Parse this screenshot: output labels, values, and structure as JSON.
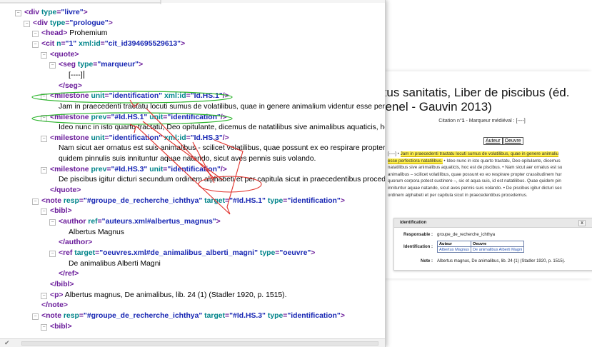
{
  "editor": {
    "lines": [
      {
        "indent": 34,
        "tog": true,
        "parts": [
          [
            "tg",
            "<div "
          ],
          [
            "at",
            "type"
          ],
          [
            "tg",
            "="
          ],
          [
            "av",
            "\"livre\""
          ],
          [
            "tg",
            ">"
          ]
        ]
      },
      {
        "indent": 46,
        "tog": true,
        "parts": [
          [
            "tg",
            "<div "
          ],
          [
            "at",
            "type"
          ],
          [
            "tg",
            "="
          ],
          [
            "av",
            "\"prologue\""
          ],
          [
            "tg",
            ">"
          ]
        ]
      },
      {
        "indent": 58,
        "tog": true,
        "parts": [
          [
            "tg",
            "<head>"
          ],
          [
            "tx",
            " Prohemium"
          ]
        ]
      },
      {
        "indent": 58,
        "tog": true,
        "parts": [
          [
            "tg",
            "<cit "
          ],
          [
            "at",
            "n"
          ],
          [
            "tg",
            "="
          ],
          [
            "av",
            "\"1\" "
          ],
          [
            "at",
            "xml:id"
          ],
          [
            "tg",
            "="
          ],
          [
            "av",
            "\"cit_id394695529613\""
          ],
          [
            "tg",
            ">"
          ]
        ]
      },
      {
        "indent": 70,
        "tog": true,
        "parts": [
          [
            "tg",
            "<quote>"
          ]
        ]
      },
      {
        "indent": 82,
        "tog": true,
        "parts": [
          [
            "tg",
            "<seg "
          ],
          [
            "at",
            "type"
          ],
          [
            "tg",
            "="
          ],
          [
            "av",
            "\"marqueur\""
          ],
          [
            "tg",
            ">"
          ]
        ]
      },
      {
        "indent": 96,
        "tog": false,
        "cursor": true,
        "parts": [
          [
            "tx",
            "[----]"
          ]
        ]
      },
      {
        "indent": 82,
        "tog": false,
        "parts": [
          [
            "tg",
            "</seg>"
          ]
        ]
      },
      {
        "indent": 70,
        "tog": true,
        "parts": [
          [
            "tg",
            "<milestone "
          ],
          [
            "at",
            "unit"
          ],
          [
            "tg",
            "="
          ],
          [
            "av",
            "\"identification\" "
          ],
          [
            "at",
            "xml:id"
          ],
          [
            "tg",
            "="
          ],
          [
            "av",
            "\"Id.HS.1\""
          ],
          [
            "tg",
            "/>"
          ]
        ]
      },
      {
        "indent": 82,
        "tog": false,
        "parts": [
          [
            "tx",
            "Jam in praecedenti tractatu locuti sumus de volatilibus, quae in genere animalium videntur esse perfectiora natatilibus."
          ]
        ]
      },
      {
        "indent": 70,
        "tog": true,
        "parts": [
          [
            "tg",
            "<milestone "
          ],
          [
            "at",
            "prev"
          ],
          [
            "tg",
            "="
          ],
          [
            "av",
            "\"#Id.HS.1\" "
          ],
          [
            "at",
            "unit"
          ],
          [
            "tg",
            "="
          ],
          [
            "av",
            "\"identification\""
          ],
          [
            "tg",
            "/>"
          ]
        ]
      },
      {
        "indent": 82,
        "tog": false,
        "parts": [
          [
            "tx",
            "Ideo nunc in isto quarto tractatu, Deo opitulante, dicemus de natatilibus sive animalibus aquaticis, hoc est de piscibus."
          ]
        ]
      },
      {
        "indent": 70,
        "tog": true,
        "parts": [
          [
            "tg",
            "<milestone "
          ],
          [
            "at",
            "unit"
          ],
          [
            "tg",
            "="
          ],
          [
            "av",
            "\"identification\" "
          ],
          [
            "at",
            "xml:id"
          ],
          [
            "tg",
            "="
          ],
          [
            "av",
            "\"Id.HS.3\""
          ],
          [
            "tg",
            "/>"
          ]
        ]
      },
      {
        "indent": 82,
        "tog": false,
        "parts": [
          [
            "tx",
            "Nam sicut aer ornatus est suis animalibus - scilicet volatilibus, quae possunt ex eo respirare propter crassitudinem humoris, quorum"
          ]
        ]
      },
      {
        "indent": 82,
        "tog": false,
        "parts": [
          [
            "tx",
            "quidem pinnulis suis innituntur aquae natando, sicut aves pennis suis volando."
          ]
        ]
      },
      {
        "indent": 70,
        "tog": true,
        "parts": [
          [
            "tg",
            "<milestone "
          ],
          [
            "at",
            "prev"
          ],
          [
            "tg",
            "="
          ],
          [
            "av",
            "\"#Id.HS.3\" "
          ],
          [
            "at",
            "unit"
          ],
          [
            "tg",
            "="
          ],
          [
            "av",
            "\"identification\""
          ],
          [
            "tg",
            "/>"
          ]
        ]
      },
      {
        "indent": 82,
        "tog": false,
        "parts": [
          [
            "tx",
            "De piscibus igitur dicturi secundum ordinem alphabeti et per capitula sicut in praecedentibus procedemus."
          ]
        ]
      },
      {
        "indent": 70,
        "tog": false,
        "parts": [
          [
            "tg",
            "</quote>"
          ]
        ]
      },
      {
        "indent": 58,
        "tog": true,
        "parts": [
          [
            "tg",
            "<note "
          ],
          [
            "at",
            "resp"
          ],
          [
            "tg",
            "="
          ],
          [
            "av",
            "\"#groupe_de_recherche_ichthya\" "
          ],
          [
            "at",
            "target"
          ],
          [
            "tg",
            "="
          ],
          [
            "av",
            "\"#Id.HS.1\" "
          ],
          [
            "at",
            "type"
          ],
          [
            "tg",
            "="
          ],
          [
            "av",
            "\"identification\""
          ],
          [
            "tg",
            ">"
          ]
        ]
      },
      {
        "indent": 70,
        "tog": true,
        "parts": [
          [
            "tg",
            "<bibl>"
          ]
        ]
      },
      {
        "indent": 82,
        "tog": true,
        "parts": [
          [
            "tg",
            "<author "
          ],
          [
            "at",
            "ref"
          ],
          [
            "tg",
            "="
          ],
          [
            "av",
            "\"auteurs.xml#albertus_magnus\""
          ],
          [
            "tg",
            ">"
          ]
        ]
      },
      {
        "indent": 96,
        "tog": false,
        "parts": [
          [
            "tx",
            "Albertus Magnus"
          ]
        ]
      },
      {
        "indent": 82,
        "tog": false,
        "parts": [
          [
            "tg",
            "</author>"
          ]
        ]
      },
      {
        "indent": 82,
        "tog": true,
        "parts": [
          [
            "tg",
            "<ref "
          ],
          [
            "at",
            "target"
          ],
          [
            "tg",
            "="
          ],
          [
            "av",
            "\"oeuvres.xml#de_animalibus_alberti_magni\" "
          ],
          [
            "at",
            "type"
          ],
          [
            "tg",
            "="
          ],
          [
            "av",
            "\"oeuvre\""
          ],
          [
            "tg",
            ">"
          ]
        ]
      },
      {
        "indent": 96,
        "tog": false,
        "parts": [
          [
            "tx",
            "De animalibus Alberti Magni"
          ]
        ]
      },
      {
        "indent": 82,
        "tog": false,
        "parts": [
          [
            "tg",
            "</ref>"
          ]
        ]
      },
      {
        "indent": 70,
        "tog": false,
        "parts": [
          [
            "tg",
            "</bibl>"
          ]
        ]
      },
      {
        "indent": 70,
        "tog": true,
        "parts": [
          [
            "tg",
            "<p>"
          ],
          [
            "tx",
            " Albertus magnus, De animalibus, lib. 24 (1) (Stadler 1920, p. 1515)."
          ]
        ]
      },
      {
        "indent": 58,
        "tog": false,
        "parts": [
          [
            "tg",
            "</note>"
          ]
        ]
      },
      {
        "indent": 58,
        "tog": true,
        "parts": [
          [
            "tg",
            "<note "
          ],
          [
            "at",
            "resp"
          ],
          [
            "tg",
            "="
          ],
          [
            "av",
            "\"#groupe_de_recherche_ichthya\" "
          ],
          [
            "at",
            "target"
          ],
          [
            "tg",
            "="
          ],
          [
            "av",
            "\"#Id.HS.3\" "
          ],
          [
            "at",
            "type"
          ],
          [
            "tg",
            "="
          ],
          [
            "av",
            "\"identification\""
          ],
          [
            "tg",
            ">"
          ]
        ]
      },
      {
        "indent": 70,
        "tog": true,
        "parts": [
          [
            "tg",
            "<bibl>"
          ]
        ]
      }
    ],
    "toggle_glyph": "⊟",
    "status_check": "✔"
  },
  "preview": {
    "title_line1": "rtus sanitatis, Liber de piscibus (éd.",
    "title_line2": "venel - Gauvin 2013)",
    "citation_prefix": "Citation n°",
    "citation_number": "1",
    "citation_suffix": " - Marqueur médiéval : [----]",
    "tab_auteur": "Auteur",
    "tab_oeuvre": "Oeuvre",
    "text_marker": "[----]",
    "text_hl_1": "Jam in praecedenti tractatu locuti sumus de volatilibus, quae in genere animaliu",
    "text_hl_2": "esse perfectiora natatilibus.",
    "text_rest_1": " • Ideo nunc in isto quarto tractatu, Deo opitulante, dicemus",
    "text_line3": "natatilibus sive animalibus aquaticis, hoc est de piscibus. • Nam sicut aer ornatus est su",
    "text_line4": "animalibus – scilicet volatilibus, quae possunt ex eo respirare propter crassitudinem hur",
    "text_line5": "quorum corpora potest sustinere –, sic et aqua suis, id est natatilibus. Quae quidem pin",
    "text_line6": "innituntur aquae natando, sicut aves pennis suis volando. • De piscibus igitur dicturi sec",
    "text_line7": "ordinem alphabeti et per capitula sicut in praecedentibus procedemus.",
    "popup": {
      "title": "identification",
      "close": "x",
      "responsable_label": "Responsable :",
      "responsable_value": "groupe_de_recherche_ichthya",
      "identification_label": "Identification :",
      "col_auteur": "Auteur",
      "col_oeuvre": "Oeuvre",
      "val_auteur": "Albertus Magnus",
      "val_oeuvre": "De animalibus Alberti Magni",
      "note_label": "Note :",
      "note_value": "Albertus magnus, De animalibus, lib. 24 (1) (Stadler 1920, p. 1515)."
    }
  },
  "annotation_colors": {
    "green": "#2db52d",
    "red": "#e0302a"
  }
}
